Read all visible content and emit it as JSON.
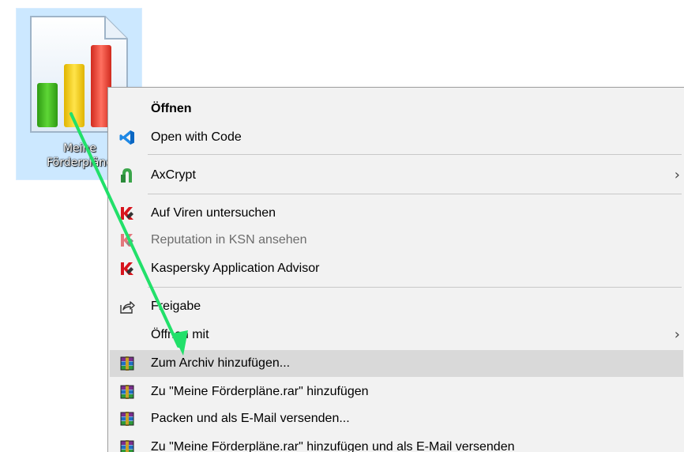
{
  "desktop": {
    "selected_icon": {
      "label_line1": "Meine",
      "label_line2": "Förderpläne",
      "icon_name": "bar-chart-document-icon",
      "bar_colors": [
        "#3dbb1f",
        "#f6d500",
        "#f03c2e"
      ]
    }
  },
  "context_menu": {
    "highlight_color": "#d9d9d9",
    "items": [
      {
        "label": "Öffnen",
        "icon": "none",
        "bold": true
      },
      {
        "label": "Open with Code",
        "icon": "vscode-icon"
      },
      {
        "label": "AxCrypt",
        "icon": "axcrypt-icon",
        "submenu": true
      },
      {
        "label": "Auf Viren untersuchen",
        "icon": "kaspersky-icon"
      },
      {
        "label": "Reputation in KSN ansehen",
        "icon": "kaspersky-icon",
        "disabled": true
      },
      {
        "label": "Kaspersky Application Advisor",
        "icon": "kaspersky-icon"
      },
      {
        "label": "Freigabe",
        "icon": "share-icon"
      },
      {
        "label": "Öffnen mit",
        "icon": "none",
        "submenu": true
      },
      {
        "label": "Zum Archiv hinzufügen...",
        "icon": "winrar-icon",
        "highlighted": true
      },
      {
        "label": "Zu \"Meine Förderpläne.rar\" hinzufügen",
        "icon": "winrar-icon"
      },
      {
        "label": "Packen und als E-Mail versenden...",
        "icon": "winrar-icon"
      },
      {
        "label": "Zu \"Meine Förderpläne.rar\" hinzufügen und als E-Mail versenden",
        "icon": "winrar-icon"
      }
    ],
    "submenu_glyph": "›"
  },
  "annotation": {
    "arrow_color": "#22e06a"
  }
}
